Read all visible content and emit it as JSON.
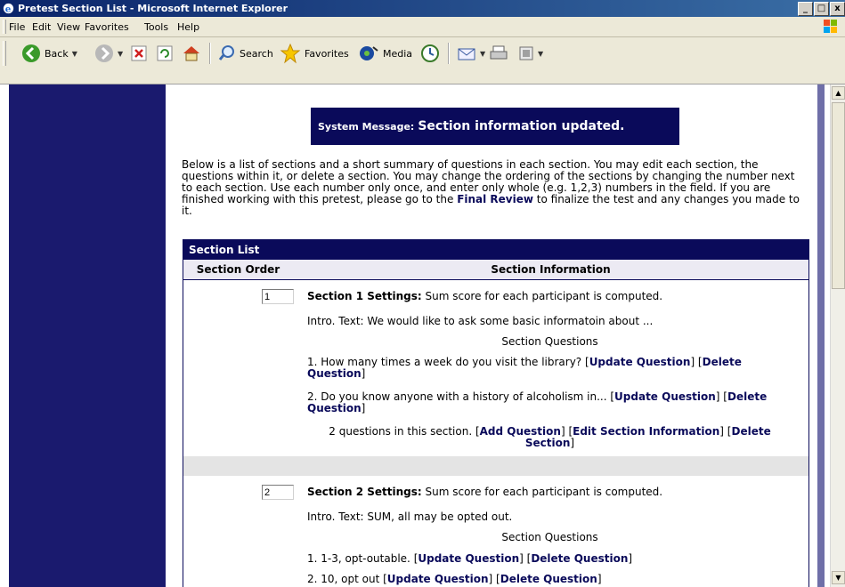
{
  "window": {
    "title": "Pretest Section List - Microsoft Internet Explorer",
    "min_label": "_",
    "max_label": "□",
    "close_label": "x"
  },
  "menu": [
    "File",
    "Edit",
    "View",
    "Favorites",
    "Tools",
    "Help"
  ],
  "toolbar": {
    "back": "Back",
    "search": "Search",
    "favorites": "Favorites",
    "media": "Media"
  },
  "system_message": {
    "prefix": "System Message:",
    "text": "Section information updated."
  },
  "intro": {
    "text": "Below is a list of sections and a short summary of questions in each section. You may edit each section, the questions within it, or delete a section. You may change the ordering of the sections by changing the number next to each section. Use each number only once, and enter only whole (e.g. 1,2,3) numbers in the field. If you are finished working with this pretest, please go to the ",
    "link": "Final Review",
    "tail": " to finalize the test and any changes you made to it."
  },
  "table": {
    "title": "Section List",
    "col_order": "Section Order",
    "col_info": "Section Information"
  },
  "sections": [
    {
      "order": "1",
      "settings_label": "Section 1 Settings:",
      "settings_text": " Sum score for each participant is computed.",
      "intro_text": "Intro. Text: We would like to ask some basic informatoin about ...",
      "questions_header": "Section Questions",
      "questions": [
        {
          "text": "1. How many times a week do you visit the library? ",
          "update": "Update Question",
          "delete": "Delete Question"
        },
        {
          "text": "2. Do you know anyone with a history of alcoholism in... ",
          "update": "Update Question",
          "delete": "Delete Question"
        }
      ],
      "summary": "2 questions in this section. ",
      "add": "Add Question",
      "edit": "Edit Section Information",
      "delete_section": "Delete Section"
    },
    {
      "order": "2",
      "settings_label": "Section 2 Settings:",
      "settings_text": " Sum score for each participant is computed.",
      "intro_text": "Intro. Text: SUM, all may be opted out.",
      "questions_header": "Section Questions",
      "questions": [
        {
          "text": "1. 1-3, opt-outable. ",
          "update": "Update Question",
          "delete": "Delete Question"
        },
        {
          "text": "2. 10, opt out ",
          "update": "Update Question",
          "delete": "Delete Question"
        }
      ]
    }
  ]
}
